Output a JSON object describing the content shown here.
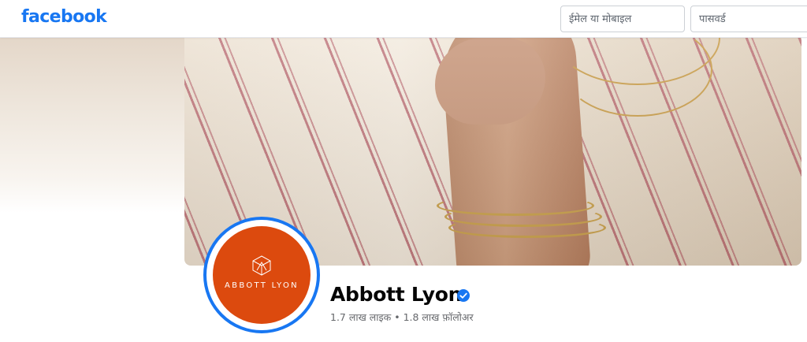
{
  "header": {
    "logo": "facebook",
    "email_placeholder": "ईमेल या मोबाइल",
    "password_placeholder": "पासवर्ड"
  },
  "profile": {
    "name": "Abbott Lyon",
    "verified": true,
    "avatar_text": "ABBOTT LYON",
    "likes": "1.7 लाख लाइक",
    "separator": "•",
    "followers": "1.8 लाख फ़ॉलोअर"
  },
  "colors": {
    "brand_blue": "#1877f2",
    "avatar_orange": "#dc4a0e"
  },
  "icons": {
    "verified": "verified-badge-icon",
    "logo_mark": "abbott-lyon-mark-icon"
  }
}
